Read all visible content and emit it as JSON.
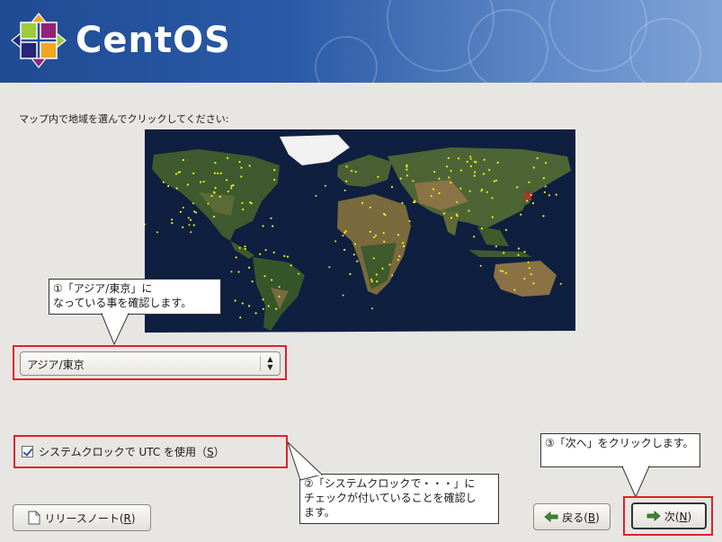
{
  "brand": {
    "name": "CentOS"
  },
  "timezone": {
    "instruction": "マップ内で地域を選んでクリックしてください:",
    "selected": "アジア/東京"
  },
  "utc": {
    "label": "システムクロックで UTC を使用（",
    "mnemonic": "S",
    "label_end": "）",
    "checked": true
  },
  "buttons": {
    "release_notes": {
      "label": "リリースノート(",
      "mnemonic": "R",
      "end": ")"
    },
    "back": {
      "label": "戻る(",
      "mnemonic": "B",
      "end": ")"
    },
    "next": {
      "label": "次(",
      "mnemonic": "N",
      "end": ")"
    }
  },
  "annotations": {
    "note1_line1": "①「アジア/東京」に",
    "note1_line2": "なっている事を確認します。",
    "note2_line1": "②「システムクロックで・・・」に",
    "note2_line2": "チェックが付いていることを確認し",
    "note2_line3": "ます。",
    "note3": "③「次へ」をクリックします。"
  },
  "colors": {
    "highlight": "#e01f2b",
    "banner": "#2a5aa6",
    "city_marker": "#f5f01c",
    "selected_marker": "#e01f2b"
  }
}
